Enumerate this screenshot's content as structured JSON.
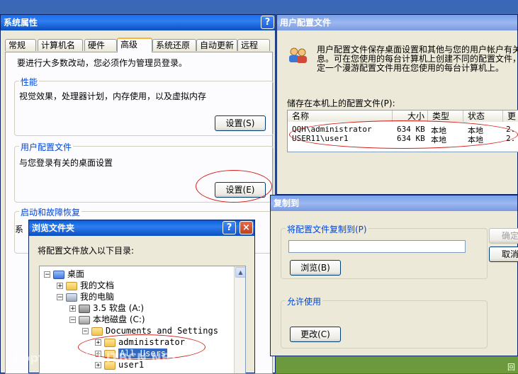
{
  "system_props": {
    "title": "系统属性",
    "help": "?",
    "tabs": [
      "常规",
      "计算机名",
      "硬件",
      "高级",
      "系统还原",
      "自动更新",
      "远程"
    ],
    "admin_note": "要进行大多数改动，您必须作为管理员登录。",
    "performance": {
      "label": "性能",
      "desc": "视觉效果，处理器计划，内存使用，以及虚拟内存",
      "button": "设置(S)"
    },
    "user_profiles": {
      "label": "用户配置文件",
      "desc": "与您登录有关的桌面设置",
      "button": "设置(E)"
    },
    "startup": {
      "label": "启动和故障恢复",
      "partial": "系"
    }
  },
  "user_profile": {
    "title": "用户配置文件",
    "desc_lines": [
      "用户配置文件保存桌面设置和其他与您的用户帐户有关",
      "息。可在您使用的每台计算机上创建不同的配置文件，",
      "定一个漫游配置文件用在您使用的每台计算机上。"
    ],
    "stored_label": "储存在本机上的配置文件(P):",
    "columns": [
      "名称",
      "大小",
      "类型",
      "状态",
      "更"
    ],
    "rows": [
      {
        "name": "QQH\\administrator",
        "size": "634 KB",
        "type": "本地",
        "status": "本地",
        "more": "2."
      },
      {
        "name": "USER11\\user1",
        "size": "634 KB",
        "type": "本地",
        "status": "本地",
        "more": "2."
      }
    ]
  },
  "copy_to": {
    "title": "复制到",
    "copy_label": "将配置文件复制到(P)",
    "path_value": "",
    "browse": "浏览(B)",
    "allow_label": "允许使用",
    "change": "更改(C)",
    "ok": "确定",
    "cancel": "取消"
  },
  "browse_folder": {
    "title": "浏览文件夹",
    "help": "?",
    "close": "×",
    "prompt": "将配置文件放入以下目录:",
    "tree": [
      {
        "label": "桌面",
        "level": 0,
        "pm": "−"
      },
      {
        "label": "我的文档",
        "level": 1,
        "pm": "+"
      },
      {
        "label": "我的电脑",
        "level": 1,
        "pm": "−"
      },
      {
        "label": "3.5 软盘 (A:)",
        "level": 2,
        "pm": "+"
      },
      {
        "label": "本地磁盘 (C:)",
        "level": 2,
        "pm": "−"
      },
      {
        "label": "Documents and Settings",
        "level": 3,
        "pm": "−"
      },
      {
        "label": "administrator",
        "level": 4,
        "pm": "+"
      },
      {
        "label": "All Users",
        "level": 4,
        "pm": "+",
        "selected": true
      },
      {
        "label": "user1",
        "level": 4,
        "pm": "+"
      }
    ]
  },
  "watermark": "Copyright (c) ITBCN.NET",
  "corner_text": "回"
}
